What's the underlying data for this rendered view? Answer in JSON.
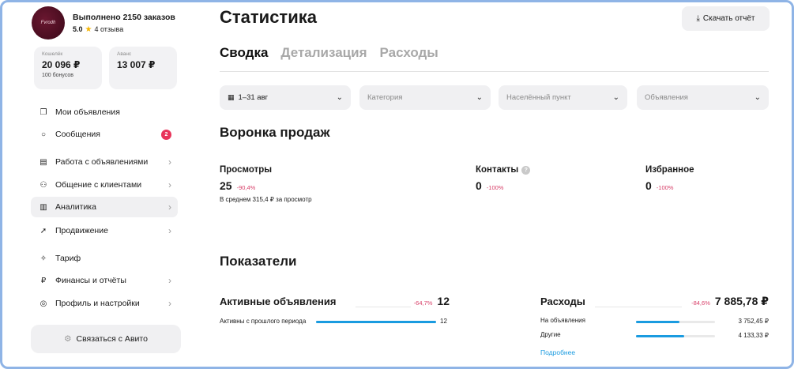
{
  "profile": {
    "avatar_text": "Fvrodh",
    "title": "Выполнено 2150 заказов",
    "rating": "5.0",
    "reviews": "4 отзыва"
  },
  "wallets": [
    {
      "label": "Кошелёк",
      "value": "20 096 ₽",
      "sub": "100 бонусов"
    },
    {
      "label": "Аванс",
      "value": "13 007 ₽",
      "sub": ""
    }
  ],
  "menu": [
    {
      "label": "Мои объявления",
      "icon": "copy-icon",
      "glyph": "❐",
      "chevron": false,
      "badge": ""
    },
    {
      "label": "Сообщения",
      "icon": "chat-icon",
      "glyph": "○",
      "chevron": false,
      "badge": "2"
    },
    {
      "label": "Работа с объявлениями",
      "icon": "list-icon",
      "glyph": "▤",
      "chevron": true,
      "badge": ""
    },
    {
      "label": "Общение с клиентами",
      "icon": "users-icon",
      "glyph": "⚇",
      "chevron": true,
      "badge": ""
    },
    {
      "label": "Аналитика",
      "icon": "chart-icon",
      "glyph": "▥",
      "chevron": true,
      "badge": ""
    },
    {
      "label": "Продвижение",
      "icon": "rocket-icon",
      "glyph": "➚",
      "chevron": true,
      "badge": ""
    },
    {
      "label": "Тариф",
      "icon": "tariff-icon",
      "glyph": "✧",
      "chevron": false,
      "badge": ""
    },
    {
      "label": "Финансы и отчёты",
      "icon": "ruble-icon",
      "glyph": "₽",
      "chevron": true,
      "badge": ""
    },
    {
      "label": "Профиль и настройки",
      "icon": "profile-icon",
      "glyph": "◎",
      "chevron": true,
      "badge": ""
    }
  ],
  "active_menu_index": 4,
  "contact_button": "Связаться с Авито",
  "page_title": "Статистика",
  "download_button": "Скачать отчёт",
  "tabs": [
    "Сводка",
    "Детализация",
    "Расходы"
  ],
  "active_tab_index": 0,
  "filters": {
    "period": "1–31 авг",
    "category": "Категория",
    "city": "Населённый пункт",
    "ads": "Объявления"
  },
  "funnel": {
    "title": "Воронка продаж",
    "views": {
      "label": "Просмотры",
      "value": "25",
      "delta": "-90,4%",
      "sub": "В среднем 315,4 ₽ за просмотр"
    },
    "contacts": {
      "label": "Контакты",
      "value": "0",
      "delta": "-100%"
    },
    "favorites": {
      "label": "Избранное",
      "value": "0",
      "delta": "-100%"
    }
  },
  "indicators": {
    "title": "Показатели",
    "active_ads": {
      "title": "Активные объявления",
      "delta": "-64,7%",
      "value": "12",
      "row_label": "Активны с прошлого периода",
      "row_value": "12",
      "row_fraction": 1.0
    },
    "expenses": {
      "title": "Расходы",
      "delta": "-84,6%",
      "value": "7 885,78 ₽",
      "rows": [
        {
          "label": "На объявления",
          "value": "3 752,45 ₽",
          "fraction": 0.55
        },
        {
          "label": "Другие",
          "value": "4 133,33 ₽",
          "fraction": 0.61
        }
      ],
      "more_link": "Подробнее"
    }
  }
}
